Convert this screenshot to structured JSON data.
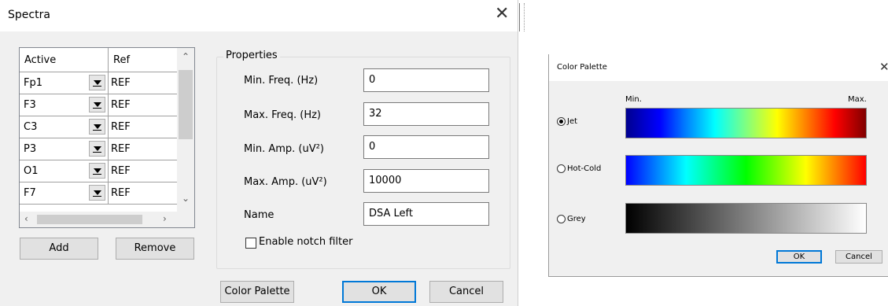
{
  "spectra": {
    "title": "Spectra",
    "close_glyph": "✕",
    "grid": {
      "headers": [
        "Active",
        "Ref"
      ],
      "rows": [
        {
          "active": "Fp1",
          "ref": "REF"
        },
        {
          "active": "F3",
          "ref": "REF"
        },
        {
          "active": "C3",
          "ref": "REF"
        },
        {
          "active": "P3",
          "ref": "REF"
        },
        {
          "active": "O1",
          "ref": "REF"
        },
        {
          "active": "F7",
          "ref": "REF"
        }
      ]
    },
    "add_label": "Add",
    "remove_label": "Remove",
    "properties": {
      "legend": "Properties",
      "fields": [
        {
          "label": "Min. Freq. (Hz)",
          "value": "0"
        },
        {
          "label": "Max. Freq. (Hz)",
          "value": "32"
        },
        {
          "label": "Min. Amp. (uV²)",
          "value": "0"
        },
        {
          "label": "Max. Amp. (uV²)",
          "value": "10000"
        },
        {
          "label": "Name",
          "value": "DSA Left"
        }
      ],
      "notch_label": "Enable notch filter",
      "notch_checked": false
    },
    "color_palette_label": "Color Palette",
    "ok_label": "OK",
    "cancel_label": "Cancel"
  },
  "palette": {
    "title": "Color Palette",
    "close_glyph": "✕",
    "min_label": "Min.",
    "max_label": "Max.",
    "options": [
      {
        "label": "Jet",
        "checked": true
      },
      {
        "label": "Hot-Cold",
        "checked": false
      },
      {
        "label": "Grey",
        "checked": false
      }
    ],
    "ok_label": "OK",
    "cancel_label": "Cancel"
  }
}
